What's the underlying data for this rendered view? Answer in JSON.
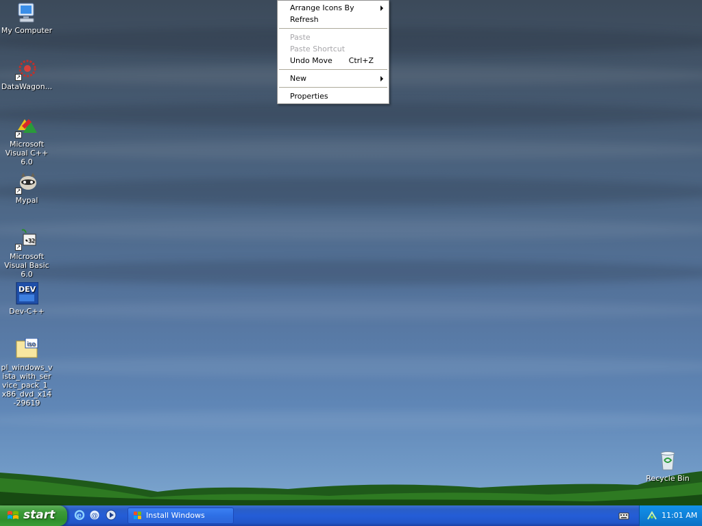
{
  "desktop": {
    "icons": [
      {
        "label": "My Computer",
        "icon": "my-computer-icon"
      },
      {
        "label": "DataWagon...",
        "icon": "datawagon-icon"
      },
      {
        "label": "Microsoft Visual C++ 6.0",
        "icon": "visual-cpp-icon"
      },
      {
        "label": "Mypal",
        "icon": "mypal-icon"
      },
      {
        "label": "Microsoft Visual Basic 6.0",
        "icon": "visual-basic-icon"
      },
      {
        "label": "Dev-C++",
        "icon": "dev-cpp-icon",
        "badge": "DEV"
      },
      {
        "label": "pl_windows_vista_with_service_pack_1_x86_dvd_x14-29619",
        "icon": "iso-file-icon",
        "badge": "iso"
      }
    ],
    "recycle_bin": {
      "label": "Recycle Bin",
      "icon": "recycle-bin-icon"
    }
  },
  "context_menu": {
    "items": [
      {
        "label": "Arrange Icons By",
        "submenu": true,
        "disabled": false
      },
      {
        "label": "Refresh",
        "disabled": false
      },
      {
        "label": "Paste",
        "disabled": true
      },
      {
        "label": "Paste Shortcut",
        "disabled": true
      },
      {
        "label": "Undo Move",
        "shortcut": "Ctrl+Z",
        "disabled": false
      },
      {
        "label": "New",
        "submenu": true,
        "disabled": false
      },
      {
        "label": "Properties",
        "disabled": false
      }
    ]
  },
  "taskbar": {
    "start_label": "start",
    "quick_launch": [
      "internet-explorer-icon",
      "outlook-express-icon",
      "media-player-icon"
    ],
    "task_button": {
      "label": "Install Windows",
      "icon": "windows-flag-icon"
    },
    "tray": {
      "clock": "11:01 AM",
      "icons": [
        "keyboard-icon",
        "network-tray-icon"
      ]
    }
  },
  "colors": {
    "taskbar": "#245dd7",
    "start": "#3c9a39",
    "tray": "#0f82da",
    "menu_disabled": "#a7a6aa"
  }
}
